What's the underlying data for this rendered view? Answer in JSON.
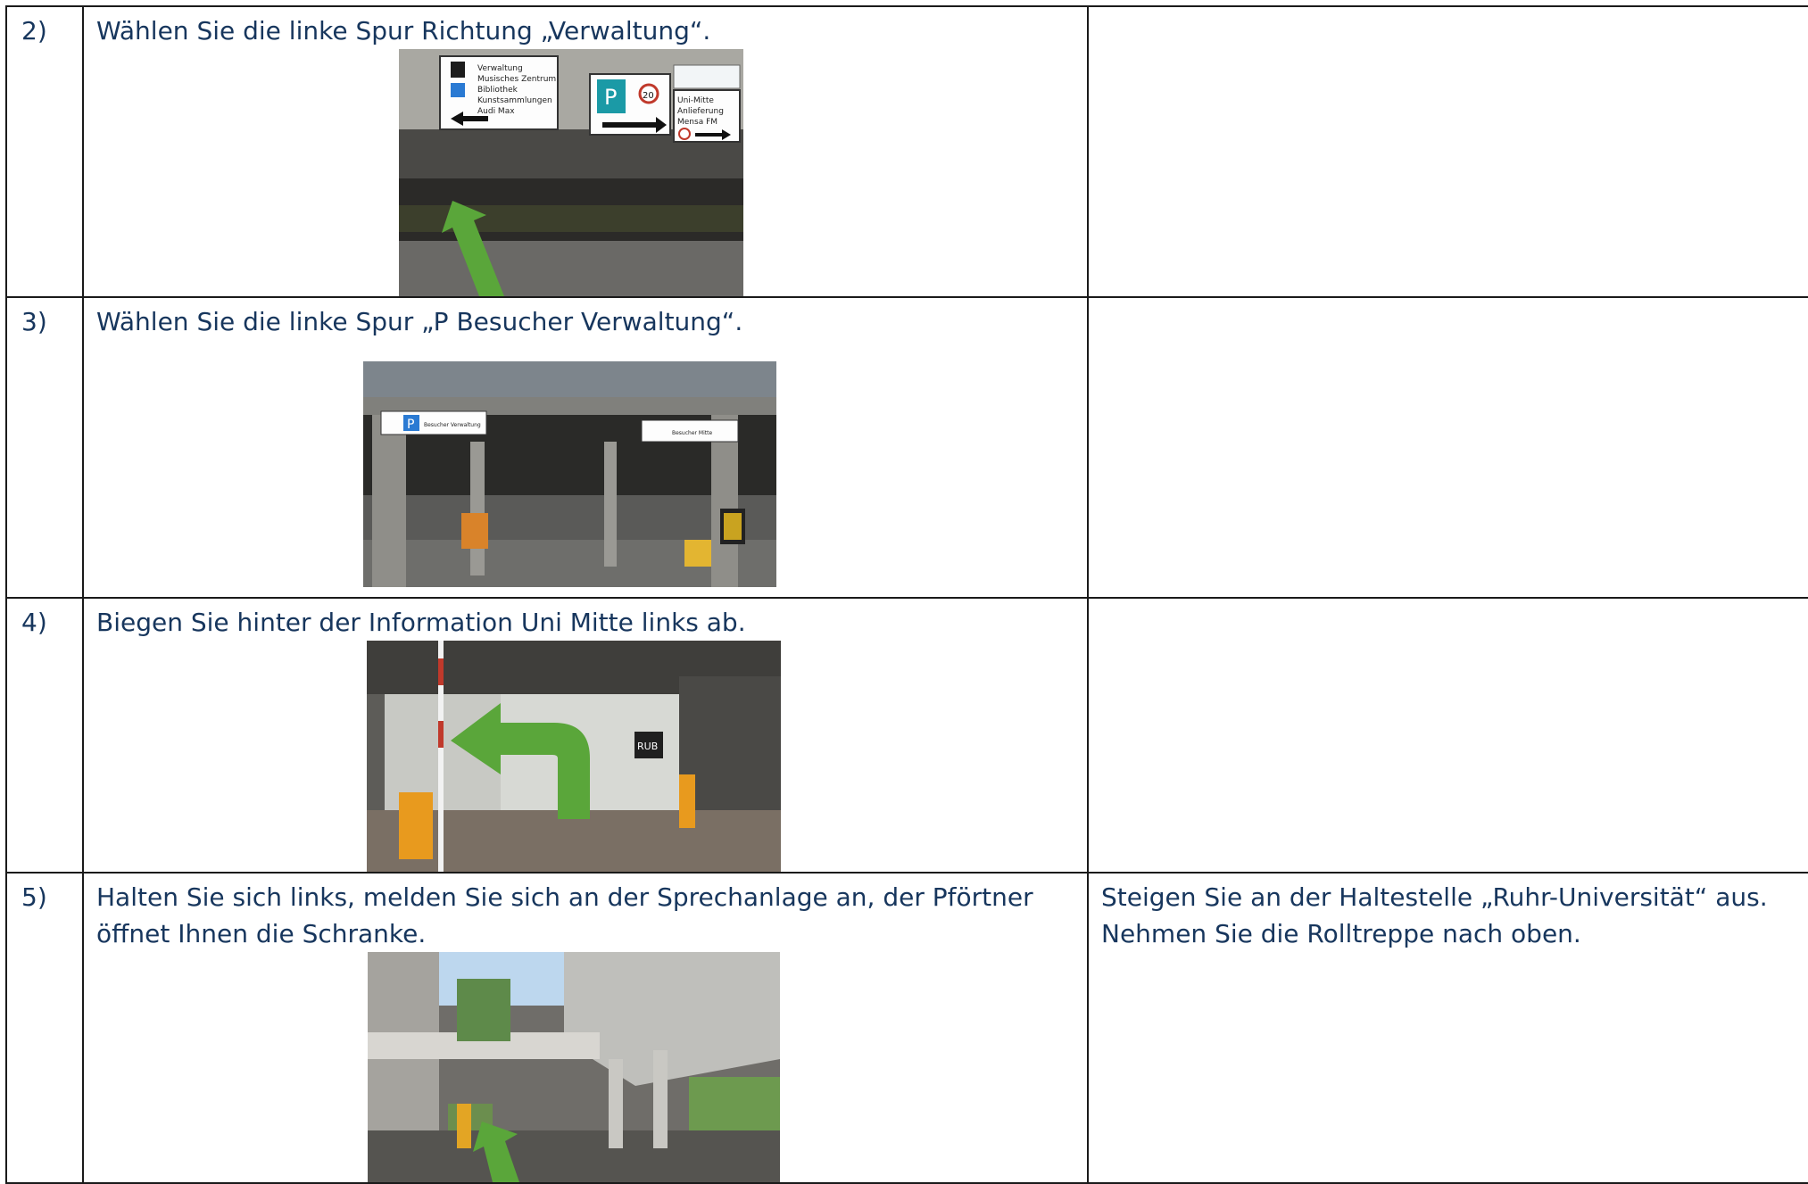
{
  "rows": [
    {
      "step": "2)",
      "text": "Wählen Sie die linke Spur Richtung „Verwaltung“.",
      "right": "",
      "photo": {
        "description": "underpass-signs",
        "sign_lines": [
          "Verwaltung",
          "Musisches Zentrum",
          "Bibliothek",
          "Kunstsammlungen",
          "Audi Max"
        ],
        "parking_label": "P",
        "right_sign_lines": [
          "Uni-Mitte",
          "Anlieferung",
          "Mensa FM"
        ],
        "speed": "20"
      }
    },
    {
      "step": "3)",
      "text": "Wählen Sie die linke Spur „P Besucher Verwaltung“.",
      "right": "",
      "photo": {
        "parking_label": "P",
        "left_sign": "Besucher Verwaltung",
        "right_sign": "Besucher Mitte"
      }
    },
    {
      "step": "4)",
      "text": "Biegen Sie hinter der Information Uni Mitte links ab.",
      "right": "",
      "photo": {
        "label": "RUB"
      }
    },
    {
      "step": "5)",
      "text": "Halten Sie sich links, melden Sie sich an der Sprechanlage an, der Pförtner öffnet Ihnen die Schranke.",
      "right": "Steigen Sie an der Haltestelle „Ruhr-Universität“ aus. Nehmen Sie die Rolltreppe nach oben.",
      "photo": {}
    }
  ],
  "colors": {
    "text": "#17365d",
    "arrow": "#5aa63a",
    "border": "#1a1a1a"
  }
}
